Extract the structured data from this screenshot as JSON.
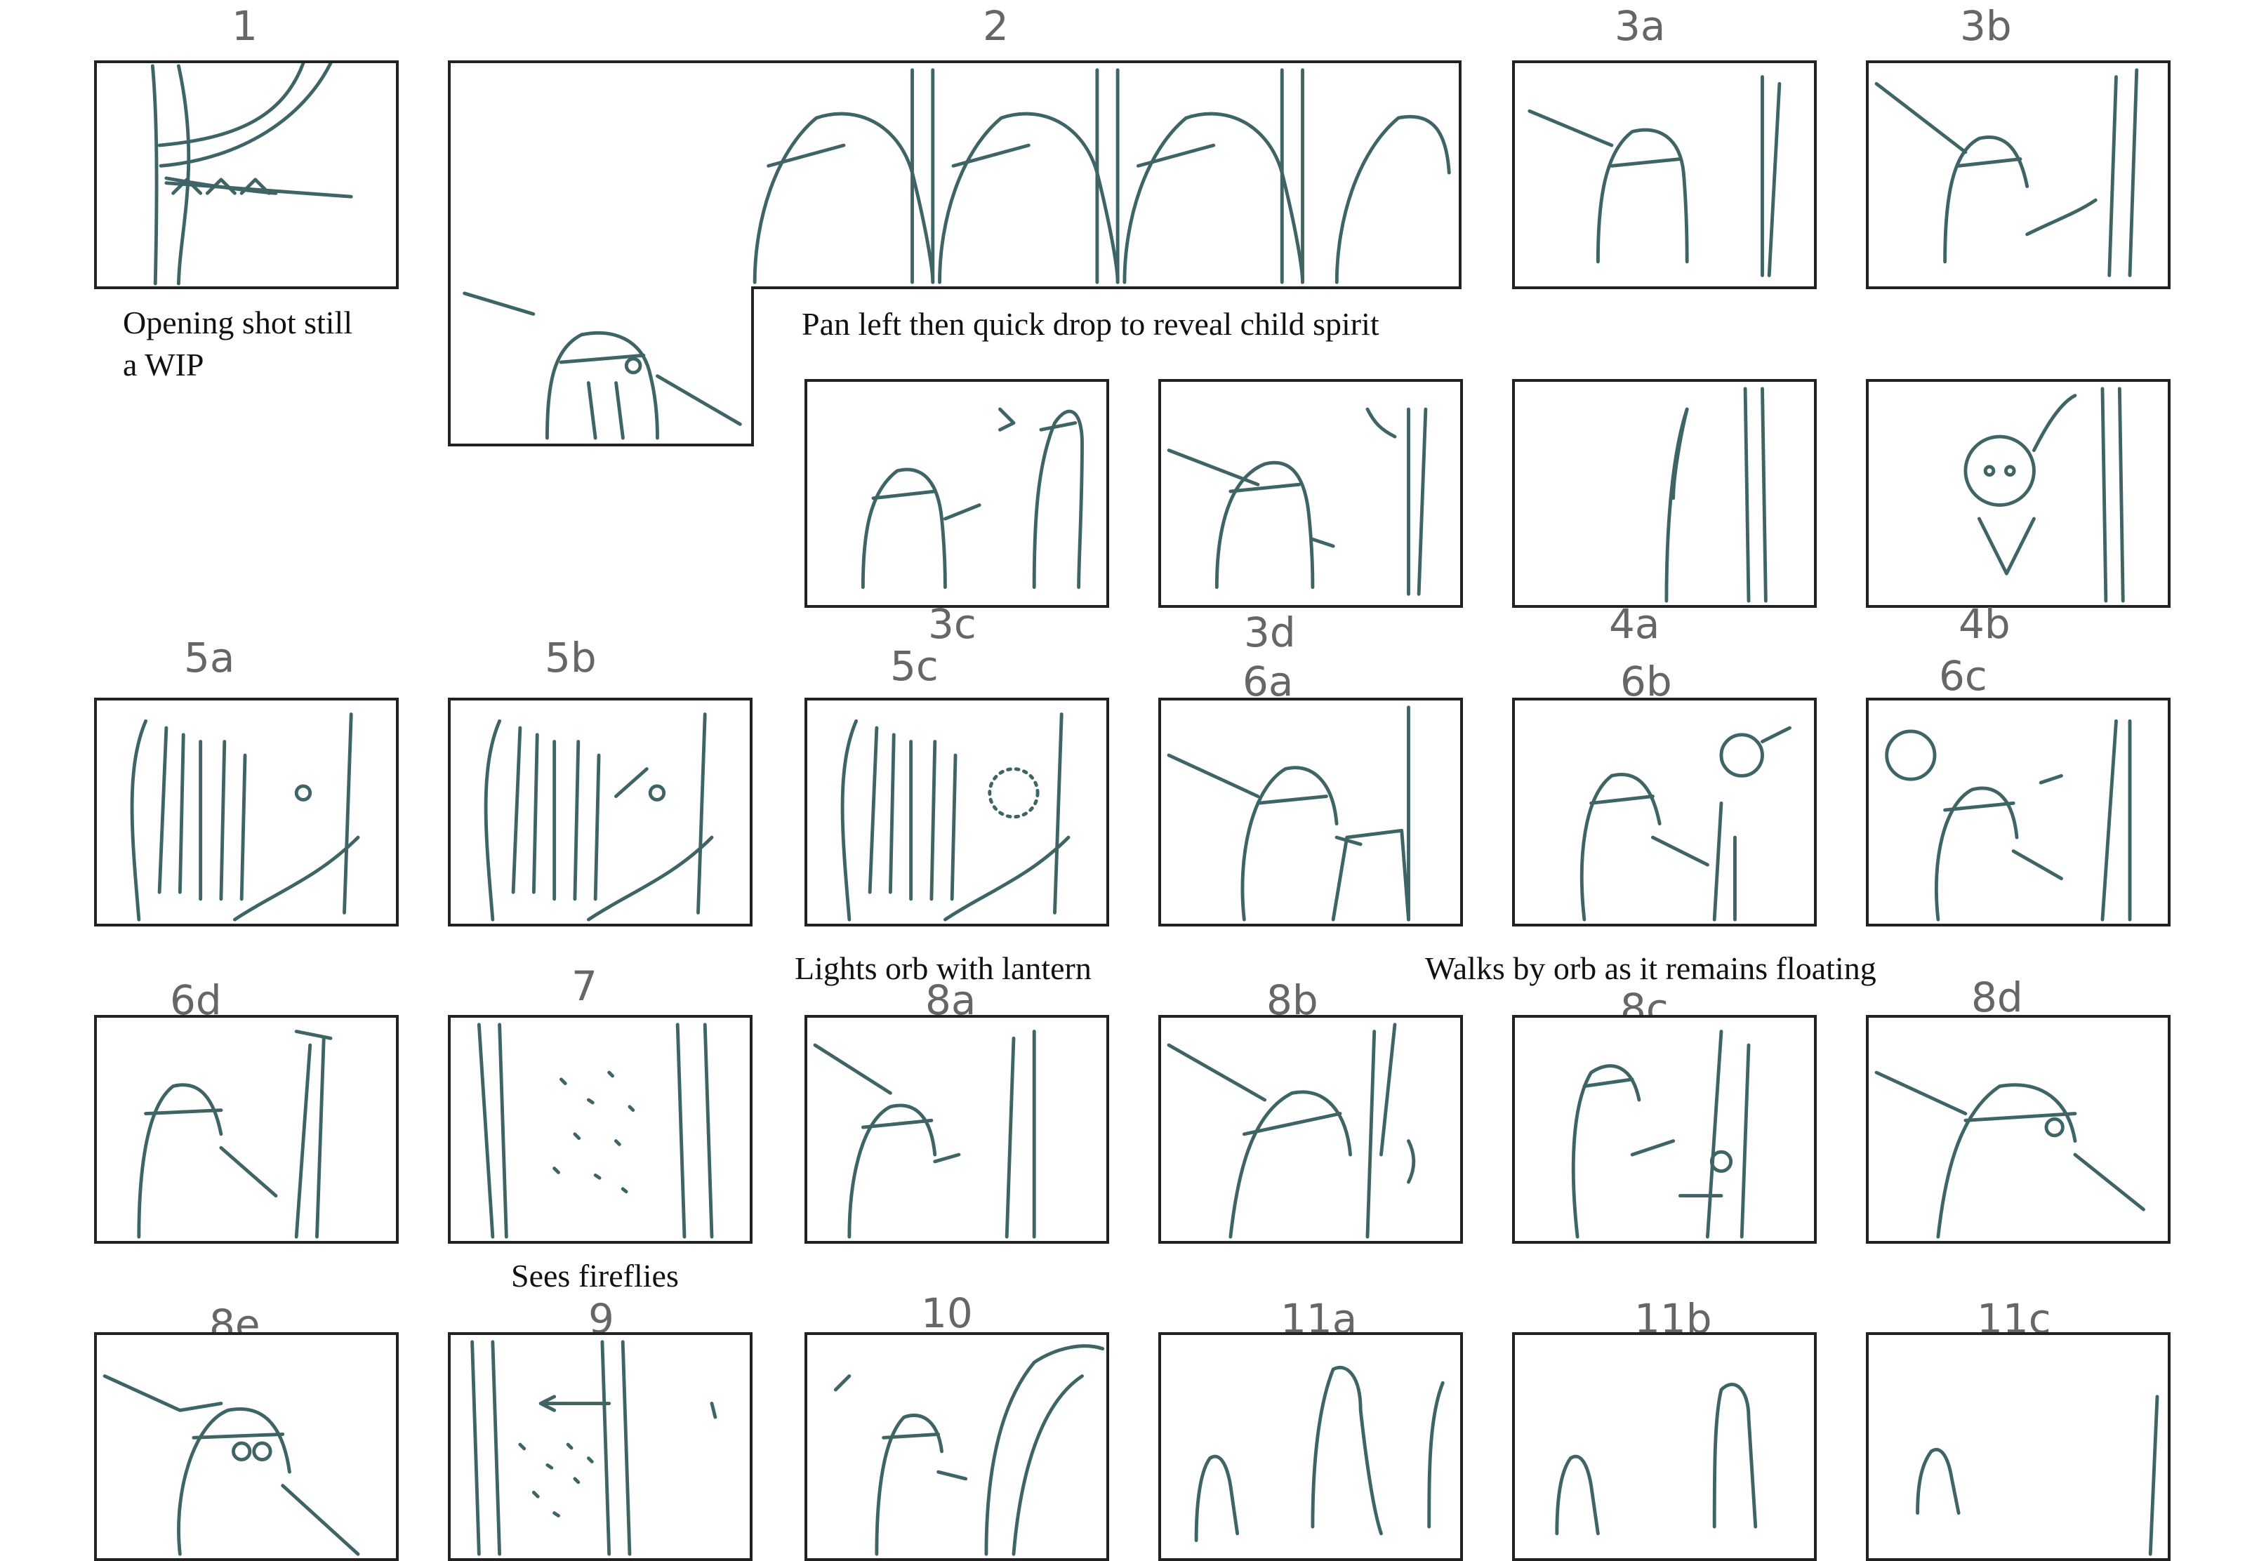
{
  "panel_numbers": {
    "p1": "1",
    "p2": "2",
    "p3a": "3a",
    "p3b": "3b",
    "p3c": "3c",
    "p3d": "3d",
    "p4a": "4a",
    "p4b": "4b",
    "p5a": "5a",
    "p5b": "5b",
    "p5c": "5c",
    "p6a": "6a",
    "p6b": "6b",
    "p6c": "6c",
    "p6d": "6d",
    "p7": "7",
    "p8a": "8a",
    "p8b": "8b",
    "p8c": "8c",
    "p8d": "8d",
    "p8e": "8e",
    "p9": "9",
    "p10": "10",
    "p11a": "11a",
    "p11b": "11b",
    "p11c": "11c"
  },
  "captions": {
    "opening": "Opening shot still\na WIP",
    "pan": "Pan left then quick drop to reveal child spirit",
    "lights": "Lights orb with lantern",
    "walks": "Walks by orb as it remains floating",
    "fireflies": "Sees fireflies"
  },
  "colors": {
    "sketch_stroke": "#3f6466",
    "panel_border": "#222222",
    "number_text": "#666666",
    "caption_text": "#111111"
  }
}
